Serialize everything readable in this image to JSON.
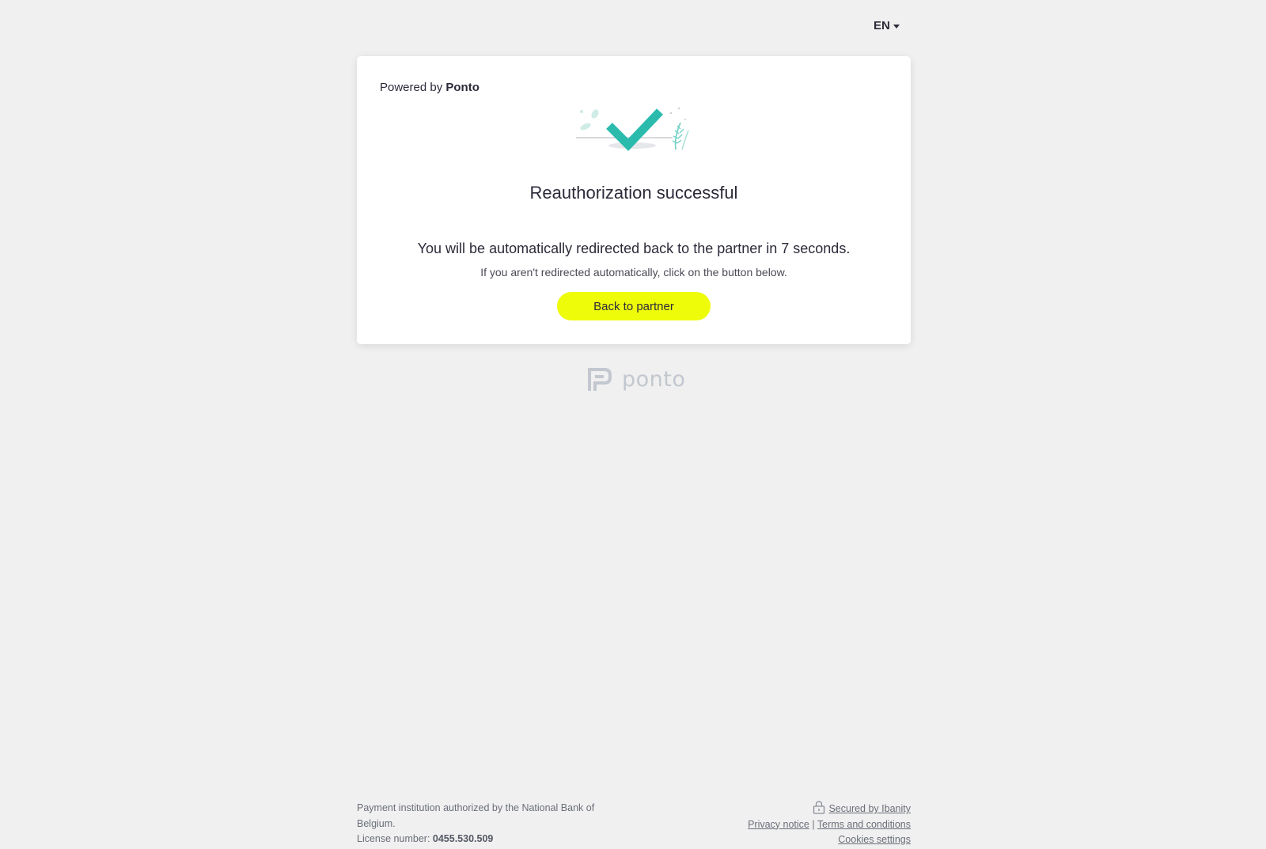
{
  "language": {
    "current": "EN"
  },
  "card": {
    "powered_prefix": "Powered by",
    "powered_brand": "Ponto",
    "title": "Reauthorization successful",
    "redirect_message": "You will be automatically redirected back to the partner in 7 seconds.",
    "hint": "If you aren't redirected automatically, click on the button below.",
    "button_label": "Back to partner"
  },
  "brand": {
    "logo_text": "ponto"
  },
  "footer": {
    "authorization_text": "Payment institution authorized by the National Bank of Belgium.",
    "license_label": "License number:",
    "license_number": "0455.530.509",
    "secured_by": "Secured by Ibanity",
    "privacy_notice": "Privacy notice",
    "separator": "|",
    "terms": "Terms and conditions",
    "cookies": "Cookies settings"
  },
  "colors": {
    "background": "#f0f0f0",
    "button": "#eefc0a",
    "check": "#2bbbad",
    "text": "#2b2b3a"
  },
  "icons": {
    "success": "checkmark-illustration",
    "lock": "lock-icon",
    "caret": "caret-down-icon",
    "logo": "ponto-logo-icon"
  }
}
